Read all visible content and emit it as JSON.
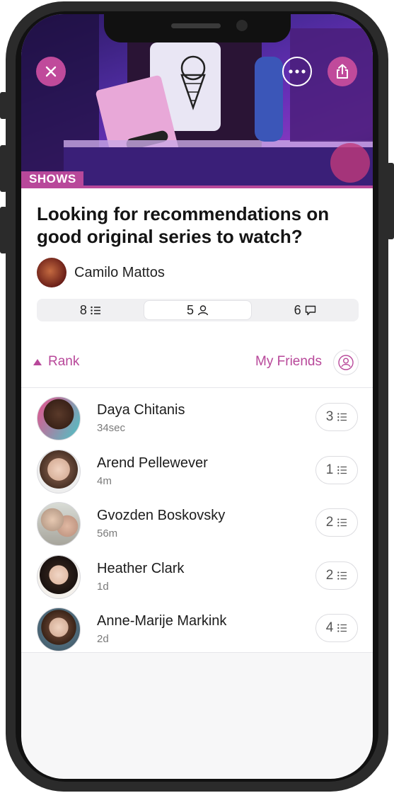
{
  "header": {
    "category_tag": "SHOWS"
  },
  "post": {
    "title": "Looking for recommendations on good original series to watch?",
    "author": "Camilo Mattos"
  },
  "stats": {
    "lists": "8",
    "people": "5",
    "comments": "6"
  },
  "filters": {
    "sort_label": "Rank",
    "scope_label": "My Friends"
  },
  "respondents": [
    {
      "name": "Daya Chitanis",
      "time": "34sec",
      "count": "3"
    },
    {
      "name": "Arend Pellewever",
      "time": "4m",
      "count": "1"
    },
    {
      "name": "Gvozden Boskovsky",
      "time": "56m",
      "count": "2"
    },
    {
      "name": "Heather Clark",
      "time": "1d",
      "count": "2"
    },
    {
      "name": "Anne-Marije Markink",
      "time": "2d",
      "count": "4"
    }
  ],
  "colors": {
    "accent": "#b8489a",
    "frame": "#2b2b2b"
  },
  "icons": [
    "close-icon",
    "more-icon",
    "share-icon",
    "list-icon",
    "person-icon",
    "comment-icon",
    "triangle-up-icon",
    "user-circle-icon"
  ]
}
